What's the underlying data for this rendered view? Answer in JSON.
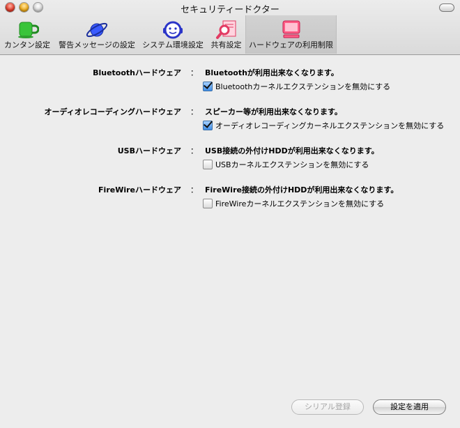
{
  "window": {
    "title": "セキュリティードクター"
  },
  "toolbar": {
    "items": [
      {
        "label": "カンタン設定",
        "icon": "mug-icon",
        "color": "#3cc23c"
      },
      {
        "label": "警告メッセージの設定",
        "icon": "planet-icon",
        "color": "#3a57ff"
      },
      {
        "label": "システム環境設定",
        "icon": "headset-icon",
        "color": "#2b35c8"
      },
      {
        "label": "共有設定",
        "icon": "magnifier-icon",
        "color": "#ff5a7a"
      },
      {
        "label": "ハードウェアの利用制限",
        "icon": "monitor-icon",
        "color": "#ff5d86",
        "selected": true
      }
    ]
  },
  "hardware_settings": [
    {
      "label": "Bluetoothハードウェア",
      "colon": "：",
      "description": "Bluetoothが利用出来なくなります。",
      "checkbox": {
        "label": "Bluetoothカーネルエクステンションを無効にする",
        "checked": true
      }
    },
    {
      "label": "オーディオレコーディングハードウェア",
      "colon": "：",
      "description": "スピーカー等が利用出来なくなります。",
      "checkbox": {
        "label": "オーディオレコーディングカーネルエクステンションを無効にする",
        "checked": true
      }
    },
    {
      "label": "USBハードウェア",
      "colon": "：",
      "description": "USB接続の外付けHDDが利用出来なくなります。",
      "checkbox": {
        "label": "USBカーネルエクステンションを無効にする",
        "checked": false
      }
    },
    {
      "label": "FireWireハードウェア",
      "colon": "：",
      "description": "FireWire接続の外付けHDDが利用出来なくなります。",
      "checkbox": {
        "label": "FireWireカーネルエクステンションを無効にする",
        "checked": false
      }
    }
  ],
  "buttons": {
    "serial_label": "シリアル登録",
    "serial_enabled": false,
    "apply_label": "設定を適用"
  }
}
